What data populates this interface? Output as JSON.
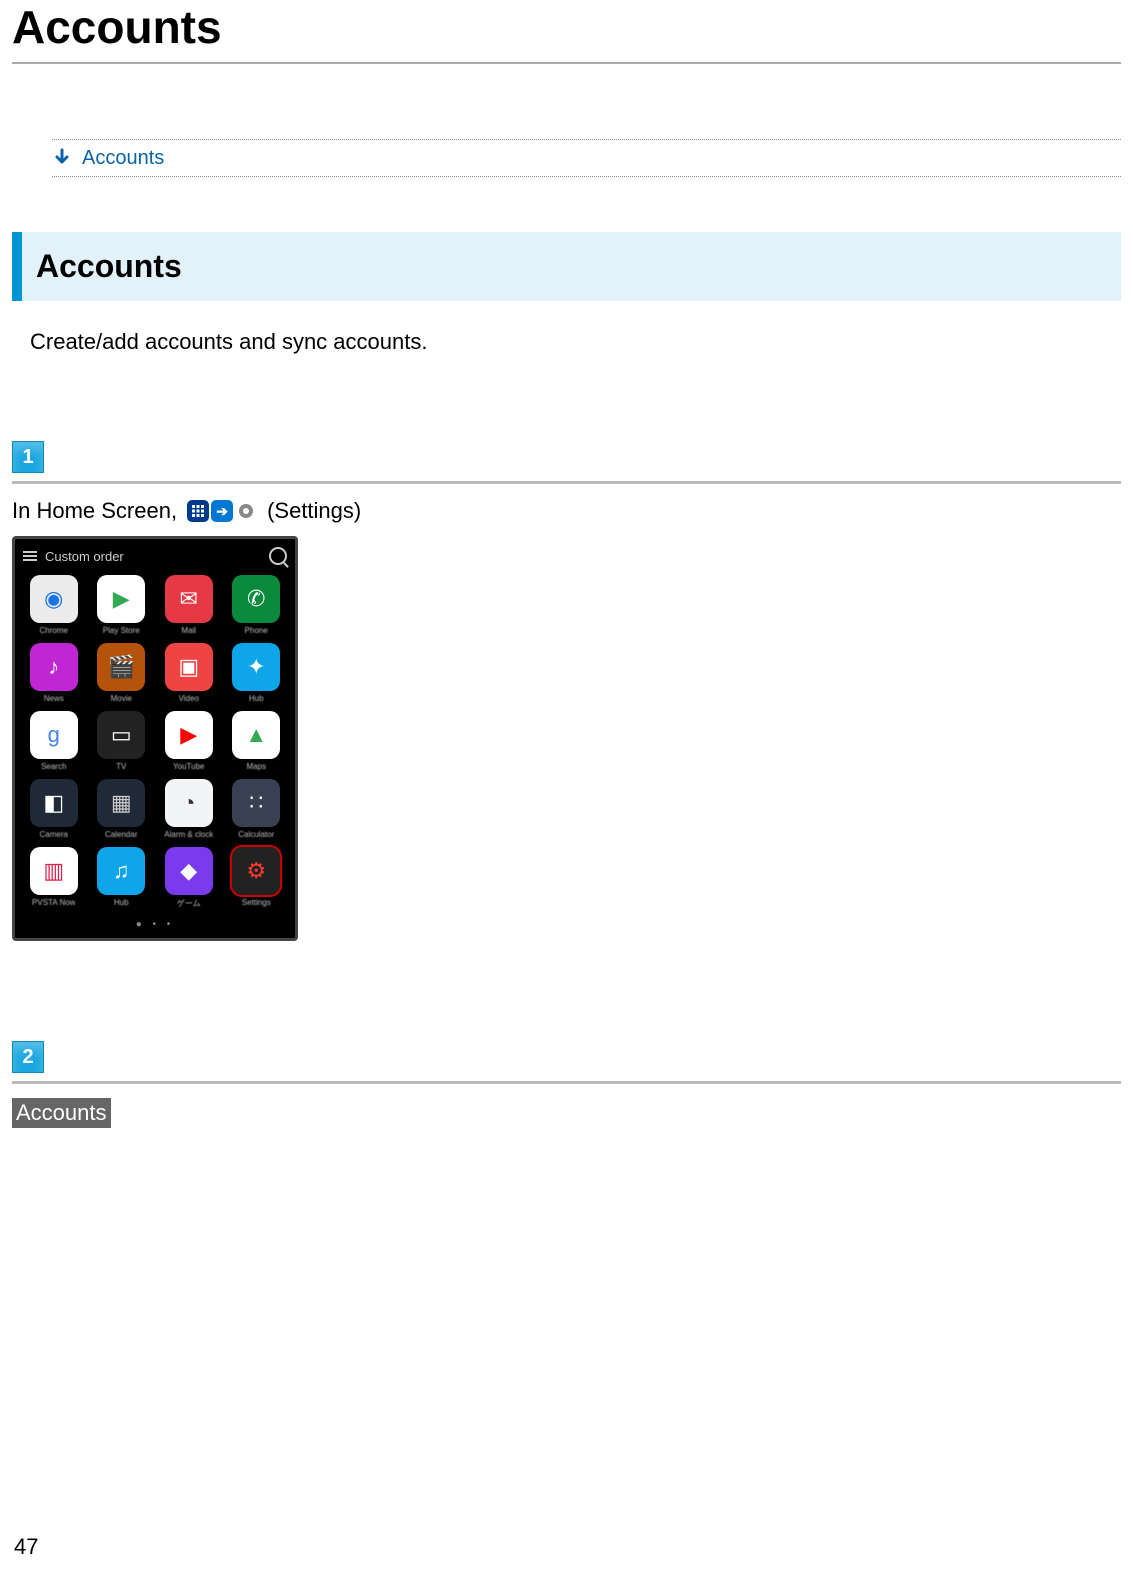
{
  "page": {
    "title": "Accounts",
    "number": "47"
  },
  "toc": {
    "link_label": "Accounts"
  },
  "section": {
    "heading": "Accounts",
    "description": "Create/add accounts and sync accounts."
  },
  "steps": {
    "s1_badge": "1",
    "s1_prefix": "In Home Screen, ",
    "s1_suffix": " (Settings)",
    "s2_badge": "2",
    "s2_label": "Accounts"
  },
  "phone": {
    "header": "Custom order",
    "apps": [
      {
        "label": "Chrome",
        "bg": "#ececec",
        "glyph": "◉",
        "fg": "#1a73e8"
      },
      {
        "label": "Play Store",
        "bg": "#ffffff",
        "glyph": "▶",
        "fg": "#34a853"
      },
      {
        "label": "Mail",
        "bg": "#e63946",
        "glyph": "✉",
        "fg": "#fff"
      },
      {
        "label": "Phone",
        "bg": "#0b8a3e",
        "glyph": "✆",
        "fg": "#fff"
      },
      {
        "label": "News",
        "bg": "#c026d3",
        "glyph": "♪",
        "fg": "#fff"
      },
      {
        "label": "Movie",
        "bg": "#b45309",
        "glyph": "🎬",
        "fg": "#fff"
      },
      {
        "label": "Video",
        "bg": "#ef4444",
        "glyph": "▣",
        "fg": "#fff"
      },
      {
        "label": "Hub",
        "bg": "#0ea5e9",
        "glyph": "✦",
        "fg": "#fff"
      },
      {
        "label": "Search",
        "bg": "#ffffff",
        "glyph": "g",
        "fg": "#4285f4"
      },
      {
        "label": "TV",
        "bg": "#222222",
        "glyph": "▭",
        "fg": "#fff"
      },
      {
        "label": "YouTube",
        "bg": "#ffffff",
        "glyph": "▶",
        "fg": "#ff0000"
      },
      {
        "label": "Maps",
        "bg": "#ffffff",
        "glyph": "▲",
        "fg": "#34a853"
      },
      {
        "label": "Camera",
        "bg": "#1f2937",
        "glyph": "◧",
        "fg": "#fff"
      },
      {
        "label": "Calendar",
        "bg": "#1f2937",
        "glyph": "▦",
        "fg": "#ccc"
      },
      {
        "label": "Alarm & clock",
        "bg": "#f3f4f6",
        "glyph": "◔",
        "fg": "#333"
      },
      {
        "label": "Calculator",
        "bg": "#374151",
        "glyph": "∷",
        "fg": "#fff"
      },
      {
        "label": "PVSTA Now",
        "bg": "#ffffff",
        "glyph": "▥",
        "fg": "#e11d48"
      },
      {
        "label": "Hub",
        "bg": "#0ea5e9",
        "glyph": "♫",
        "fg": "#fff"
      },
      {
        "label": "ゲーム",
        "bg": "#7c3aed",
        "glyph": "◆",
        "fg": "#fff"
      },
      {
        "label": "Settings",
        "bg": "#222222",
        "glyph": "⚙",
        "fg": "#ff3b30",
        "frame": true
      }
    ]
  }
}
